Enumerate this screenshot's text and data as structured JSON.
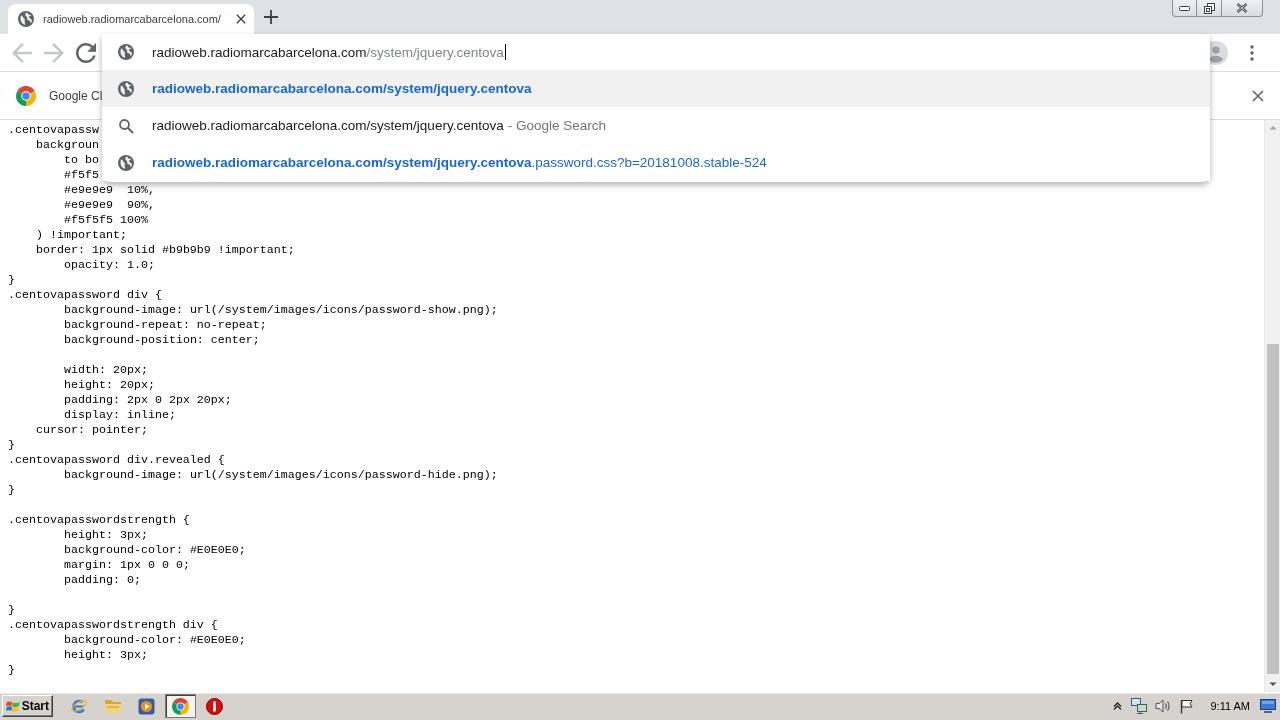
{
  "tab_strip": {
    "tabs": [
      {
        "title": "radioweb.radiomarcabarcelona.com/",
        "selected": true
      }
    ]
  },
  "toolbar": {
    "nav": [
      {
        "kind": "back",
        "disabled": true
      },
      {
        "kind": "forward",
        "disabled": true
      },
      {
        "kind": "reload",
        "disabled": false
      }
    ]
  },
  "omnibox": {
    "host": "radioweb.radiomarcabarcelona.com",
    "path": "/system/jquery.centova",
    "suggestions": [
      {
        "kind": "url",
        "text": "radioweb.radiomarcabarcelona.com/system/jquery.centova",
        "selected": true
      },
      {
        "kind": "search",
        "text": "radioweb.radiomarcabarcelona.com/system/jquery.centova",
        "suffix": "- Google Search",
        "selected": false
      },
      {
        "kind": "url",
        "text": "radioweb.radiomarcabarcelona.com/system/jquery.centova",
        "suffix": ".password.css?b=20181008.stable-524",
        "selected": false
      }
    ]
  },
  "infobar": {
    "text": "Google Cl"
  },
  "page": {
    "code_blocks": [
      [
        ".centovapassw",
        "    backgroun",
        "        to bo",
        "        #f5f5",
        "        #e9e9e9  10%,",
        "        #e9e9e9  90%,",
        "        #f5f5f5 100%",
        "    ) !important;",
        "    border: 1px solid #b9b9b9 !important;",
        "        opacity: 1.0;",
        "}",
        ".centovapassword div {",
        "        background-image: url(/system/images/icons/password-show.png);",
        "        background-repeat: no-repeat;",
        "        background-position: center;"
      ],
      [
        "        width: 20px;",
        "        height: 20px;",
        "        padding: 2px 0 2px 20px;",
        "        display: inline;",
        "    cursor: pointer;",
        "}",
        ".centovapassword div.revealed {",
        "        background-image: url(/system/images/icons/password-hide.png);",
        "}"
      ],
      [
        ".centovapasswordstrength {",
        "        height: 3px;",
        "        background-color: #E0E0E0;",
        "        margin: 1px 0 0 0;",
        "        padding: 0;"
      ],
      [
        "}",
        ".centovapasswordstrength div {",
        "        background-color: #E0E0E0;",
        "        height: 3px;",
        "}"
      ]
    ]
  },
  "taskbar": {
    "start_label": "Start",
    "apps": [
      {
        "kind": "ie",
        "selected": false
      },
      {
        "kind": "folder",
        "selected": false
      },
      {
        "kind": "media",
        "selected": false
      },
      {
        "kind": "chrome",
        "selected": true
      },
      {
        "kind": "stop",
        "selected": false
      }
    ],
    "clock": "9:11 AM"
  }
}
